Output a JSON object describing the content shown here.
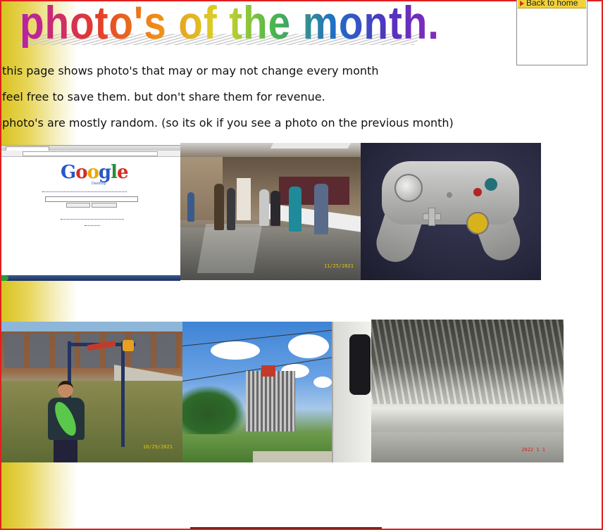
{
  "page": {
    "title": "photo's of the month.",
    "back_button_label": "Back to home",
    "lines": [
      "this page shows photo's that may or may not change every month",
      "feel free to save them. but don't share them for revenue.",
      "photo's are mostly random. (so its ok if you see a photo on the previous month)"
    ]
  },
  "photos": [
    {
      "subject": "google-desktop-screenshot",
      "google_logo": "Google",
      "google_sub": "Desktop"
    },
    {
      "subject": "people-at-serving-table",
      "date_stamp": "11/25/2021"
    },
    {
      "subject": "gamecube-controller"
    },
    {
      "subject": "boy-on-playground",
      "date_stamp": "10/29/2021"
    },
    {
      "subject": "rocket-test-stand"
    },
    {
      "subject": "waterfall-dam",
      "date_stamp": "2022 1 1"
    }
  ],
  "colors": {
    "frame": "#e02020",
    "left_gradient": "#d8c21c",
    "back_button": "#f2d23a"
  }
}
